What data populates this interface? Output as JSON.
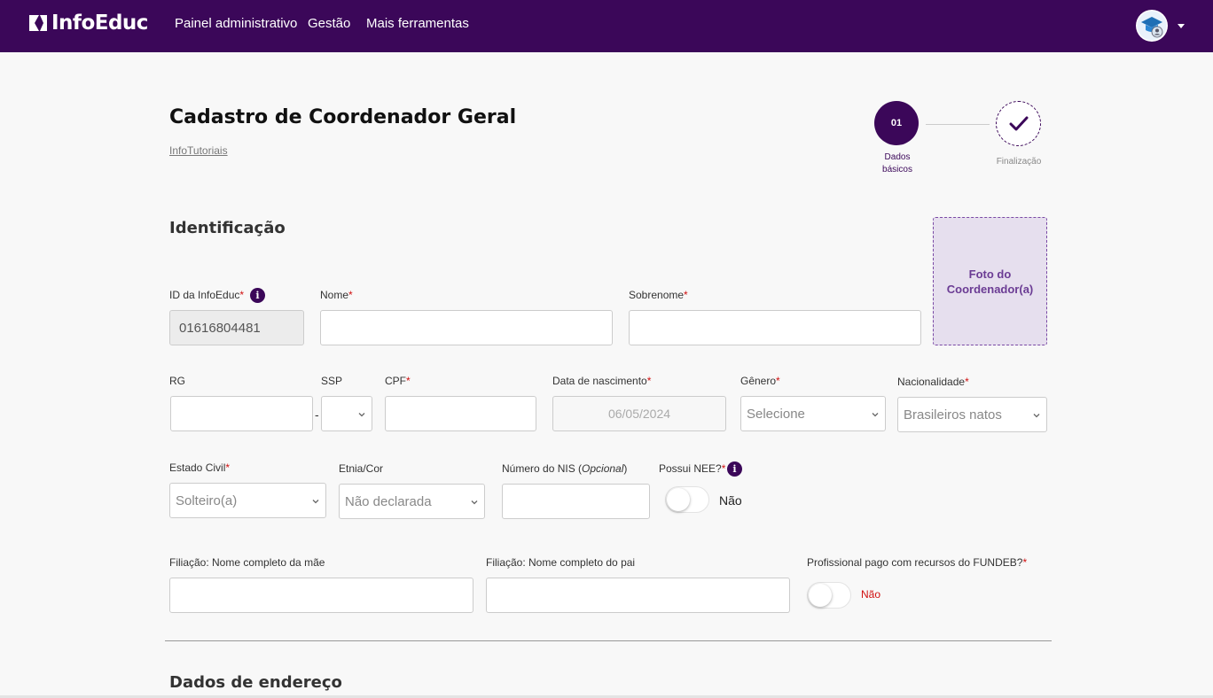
{
  "navbar": {
    "brand": "InfoEduc",
    "links": [
      "Painel administrativo",
      "Gestão",
      "Mais ferramentas"
    ]
  },
  "header": {
    "title": "Cadastro de Coordenador Geral",
    "breadcrumb": "InfoTutoriais"
  },
  "stepper": {
    "step1_number": "01",
    "step1_label_line1": "Dados",
    "step1_label_line2": "básicos",
    "step2_label": "Finalização"
  },
  "identificacao": {
    "section_title": "Identificação",
    "photo_line1": "Foto do",
    "photo_line2": "Coordenador(a)",
    "id_label": "ID da InfoEduc",
    "id_value": "01616804481",
    "nome_label": "Nome",
    "sobrenome_label": "Sobrenome",
    "rg_label": "RG",
    "ssp_label": "SSP",
    "rg_separator": "-",
    "cpf_label": "CPF",
    "nascimento_label": "Data de nascimento",
    "nascimento_value": "06/05/2024",
    "genero_label": "Gênero",
    "genero_value": "Selecione",
    "nacionalidade_label": "Nacionalidade",
    "nacionalidade_value": "Brasileiros natos",
    "estado_civil_label": "Estado Civil",
    "estado_civil_value": "Solteiro(a)",
    "etnia_label": "Etnia/Cor",
    "etnia_value": "Não declarada",
    "nis_label_prefix": "Número do NIS (",
    "nis_label_optional": "Opcional",
    "nis_label_suffix": ")",
    "nee_label": "Possui NEE?",
    "nee_value": "Não",
    "mae_label": "Filiação: Nome completo da mãe",
    "pai_label": "Filiação: Nome completo do pai",
    "fundeb_label": "Profissional pago com recursos do FUNDEB?",
    "fundeb_value": "Não",
    "required_mark": "*",
    "info_glyph": "i"
  },
  "endereco": {
    "section_title": "Dados de endereço"
  },
  "colors": {
    "brand": "#3b0759",
    "required": "#d01010",
    "photo_bg": "#e6dfee",
    "photo_text": "#6b3c94",
    "fundeb_no": "#d01010"
  },
  "icons": {
    "logo": "infoeduc-logo-icon",
    "avatar": "user-avatar-icon",
    "caret": "caret-down-icon",
    "check": "check-icon",
    "info": "info-icon",
    "chevron": "chevron-down-icon"
  }
}
